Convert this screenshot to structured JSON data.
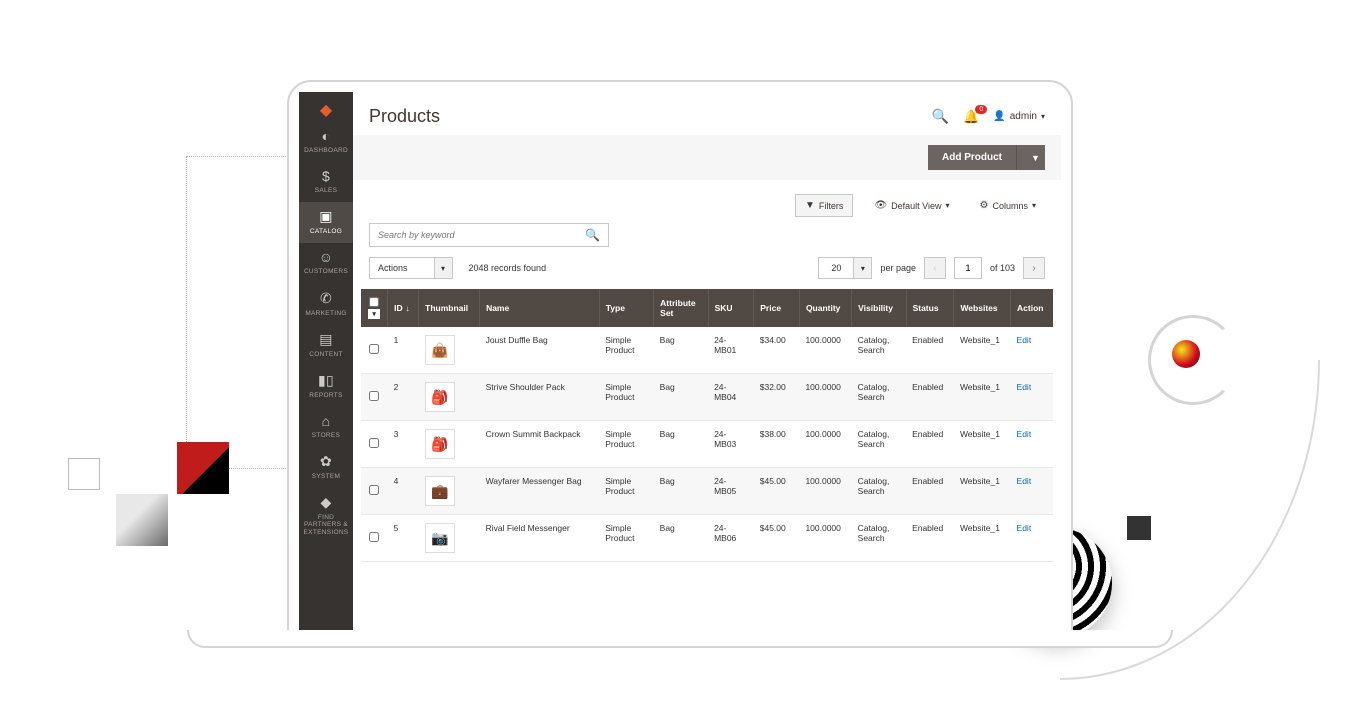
{
  "header": {
    "title": "Products",
    "notification_count": "0",
    "user_label": "admin"
  },
  "toolbar": {
    "add_product": "Add Product"
  },
  "controls": {
    "filters": "Filters",
    "default_view": "Default View",
    "columns": "Columns"
  },
  "search": {
    "placeholder": "Search by keyword"
  },
  "meta": {
    "actions_label": "Actions",
    "records_found": "2048 records found",
    "per_page_value": "20",
    "per_page_label": "per page",
    "page_current": "1",
    "page_of_label": "of 103"
  },
  "sidebar": {
    "items": [
      {
        "label": "DASHBOARD"
      },
      {
        "label": "SALES"
      },
      {
        "label": "CATALOG"
      },
      {
        "label": "CUSTOMERS"
      },
      {
        "label": "MARKETING"
      },
      {
        "label": "CONTENT"
      },
      {
        "label": "REPORTS"
      },
      {
        "label": "STORES"
      },
      {
        "label": "SYSTEM"
      },
      {
        "label": "FIND PARTNERS & EXTENSIONS"
      }
    ]
  },
  "table": {
    "headers": {
      "id": "ID",
      "thumbnail": "Thumbnail",
      "name": "Name",
      "type": "Type",
      "attribute_set": "Attribute Set",
      "sku": "SKU",
      "price": "Price",
      "quantity": "Quantity",
      "visibility": "Visibility",
      "status": "Status",
      "websites": "Websites",
      "action": "Action"
    },
    "action_label": "Edit",
    "rows": [
      {
        "id": "1",
        "name": "Joust Duffle Bag",
        "type": "Simple Product",
        "attr": "Bag",
        "sku": "24-MB01",
        "price": "$34.00",
        "qty": "100.0000",
        "vis": "Catalog, Search",
        "status": "Enabled",
        "web": "Website_1"
      },
      {
        "id": "2",
        "name": "Strive Shoulder Pack",
        "type": "Simple Product",
        "attr": "Bag",
        "sku": "24-MB04",
        "price": "$32.00",
        "qty": "100.0000",
        "vis": "Catalog, Search",
        "status": "Enabled",
        "web": "Website_1"
      },
      {
        "id": "3",
        "name": "Crown Summit Backpack",
        "type": "Simple Product",
        "attr": "Bag",
        "sku": "24-MB03",
        "price": "$38.00",
        "qty": "100.0000",
        "vis": "Catalog, Search",
        "status": "Enabled",
        "web": "Website_1"
      },
      {
        "id": "4",
        "name": "Wayfarer Messenger Bag",
        "type": "Simple Product",
        "attr": "Bag",
        "sku": "24-MB05",
        "price": "$45.00",
        "qty": "100.0000",
        "vis": "Catalog, Search",
        "status": "Enabled",
        "web": "Website_1"
      },
      {
        "id": "5",
        "name": "Rival Field Messenger",
        "type": "Simple Product",
        "attr": "Bag",
        "sku": "24-MB06",
        "price": "$45.00",
        "qty": "100.0000",
        "vis": "Catalog, Search",
        "status": "Enabled",
        "web": "Website_1"
      }
    ]
  }
}
